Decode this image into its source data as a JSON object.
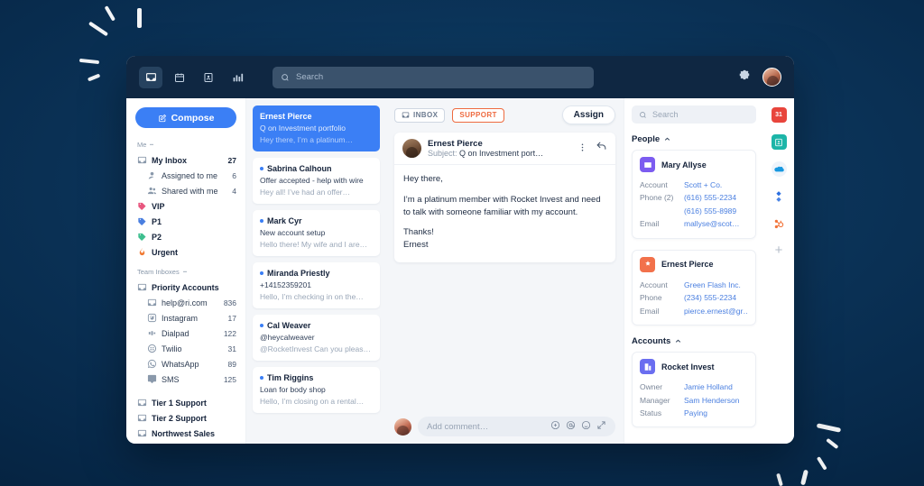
{
  "topbar": {
    "nav": [
      {
        "name": "inbox-icon",
        "label": "Inbox",
        "active": true
      },
      {
        "name": "calendar-icon",
        "label": "Calendar",
        "active": false
      },
      {
        "name": "contacts-icon",
        "label": "Contacts",
        "active": false
      },
      {
        "name": "reports-icon",
        "label": "Reports",
        "active": false
      }
    ],
    "search_placeholder": "Search",
    "settings_label": "Settings",
    "avatar_label": "Account"
  },
  "sidebar": {
    "compose_label": "Compose",
    "group_me": "Me",
    "me_items": [
      {
        "icon": "mail-icon",
        "label": "My Inbox",
        "count": "27",
        "bold": true,
        "sub": false,
        "color": "#8a99ab"
      },
      {
        "icon": "assigned-icon",
        "label": "Assigned to me",
        "count": "6",
        "bold": false,
        "sub": true,
        "color": "#8a99ab"
      },
      {
        "icon": "shared-icon",
        "label": "Shared with me",
        "count": "4",
        "bold": false,
        "sub": true,
        "color": "#8a99ab"
      },
      {
        "icon": "tag-icon",
        "label": "VIP",
        "count": "",
        "bold": true,
        "sub": false,
        "color": "#e8577f"
      },
      {
        "icon": "tag-icon",
        "label": "P1",
        "count": "",
        "bold": true,
        "sub": false,
        "color": "#4a7fe0"
      },
      {
        "icon": "tag-icon",
        "label": "P2",
        "count": "",
        "bold": true,
        "sub": false,
        "color": "#3fbf8f"
      },
      {
        "icon": "flame-icon",
        "label": "Urgent",
        "count": "",
        "bold": true,
        "sub": false,
        "color": "#f07b35"
      }
    ],
    "group_team": "Team Inboxes",
    "team_items": [
      {
        "icon": "mail-icon",
        "label": "Priority Accounts",
        "count": "",
        "bold": true,
        "sub": false,
        "color": "#8a99ab"
      },
      {
        "icon": "mail-icon",
        "label": "help@ri.com",
        "count": "836",
        "bold": false,
        "sub": true,
        "color": "#8a99ab"
      },
      {
        "icon": "instagram-icon",
        "label": "Instagram",
        "count": "17",
        "bold": false,
        "sub": true,
        "color": "#8a99ab"
      },
      {
        "icon": "dialpad-icon",
        "label": "Dialpad",
        "count": "122",
        "bold": false,
        "sub": true,
        "color": "#8a99ab"
      },
      {
        "icon": "twilio-icon",
        "label": "Twilio",
        "count": "31",
        "bold": false,
        "sub": true,
        "color": "#8a99ab"
      },
      {
        "icon": "whatsapp-icon",
        "label": "WhatsApp",
        "count": "89",
        "bold": false,
        "sub": true,
        "color": "#8a99ab"
      },
      {
        "icon": "sms-icon",
        "label": "SMS",
        "count": "125",
        "bold": false,
        "sub": true,
        "color": "#8a99ab"
      }
    ],
    "other_items": [
      {
        "icon": "mail-icon",
        "label": "Tier 1 Support",
        "count": "",
        "bold": true,
        "sub": false,
        "color": "#8a99ab"
      },
      {
        "icon": "mail-icon",
        "label": "Tier 2 Support",
        "count": "",
        "bold": true,
        "sub": false,
        "color": "#8a99ab"
      },
      {
        "icon": "mail-icon",
        "label": "Northwest Sales",
        "count": "",
        "bold": true,
        "sub": false,
        "color": "#8a99ab"
      }
    ]
  },
  "conversations": [
    {
      "name": "Ernest Pierce",
      "subject": "Q on Investment portfolio",
      "preview": "Hey there, I’m a platinum…",
      "selected": true,
      "unread": false
    },
    {
      "name": "Sabrina Calhoun",
      "subject": "Offer accepted - help with wire",
      "preview": "Hey all! I’ve had an offer…",
      "selected": false,
      "unread": true
    },
    {
      "name": "Mark Cyr",
      "subject": "New account setup",
      "preview": "Hello there! My wife and I are…",
      "selected": false,
      "unread": true
    },
    {
      "name": "Miranda Priestly",
      "subject": "+14152359201",
      "preview": "Hello, I’m checking in on the…",
      "selected": false,
      "unread": true
    },
    {
      "name": "Cal Weaver",
      "subject": "@heycalweaver",
      "preview": "@RocketInvest Can you pleas…",
      "selected": false,
      "unread": true
    },
    {
      "name": "Tim Riggins",
      "subject": "Loan for body shop",
      "preview": "Hello, I’m closing on a rental…",
      "selected": false,
      "unread": true
    }
  ],
  "message": {
    "chip_inbox": "INBOX",
    "chip_support": "SUPPORT",
    "assign_label": "Assign",
    "sender": "Ernest Pierce",
    "subject_prefix": "Subject: ",
    "subject": "Q on Investment port…",
    "more_label": "More actions",
    "reply_label": "Reply",
    "paragraphs": [
      "Hey there,",
      "I’m a platinum member with Rocket Invest and need to talk with someone familiar with my account.",
      "Thanks!\nErnest"
    ],
    "comment_placeholder": "Add comment…",
    "comment_icons": [
      "plus-circle-icon",
      "mention-icon",
      "emoji-icon",
      "expand-icon"
    ]
  },
  "details": {
    "search_placeholder": "Search",
    "people_title": "People",
    "accounts_title": "Accounts",
    "people": [
      {
        "name": "Mary Allyse",
        "icon": "contact-card-icon",
        "icon_color": "#7c5cf0",
        "rows": [
          {
            "key": "Account",
            "value": "Scott + Co."
          },
          {
            "key": "Phone (2)",
            "value": "(616) 555-2234"
          },
          {
            "key": "",
            "value": "(616) 555-8989"
          },
          {
            "key": "Email",
            "value": "mallyse@scot…"
          }
        ]
      },
      {
        "name": "Ernest Pierce",
        "icon": "star-contact-icon",
        "icon_color": "#f2714b",
        "rows": [
          {
            "key": "Account",
            "value": "Green Flash Inc."
          },
          {
            "key": "Phone",
            "value": "(234) 555-2234"
          },
          {
            "key": "Email",
            "value": "pierce.ernest@gr…"
          }
        ]
      }
    ],
    "accounts": [
      {
        "name": "Rocket Invest",
        "icon": "building-icon",
        "icon_color": "#6a6ef0",
        "rows": [
          {
            "key": "Owner",
            "value": "Jamie Holland"
          },
          {
            "key": "Manager",
            "value": "Sam Henderson"
          },
          {
            "key": "Status",
            "value": "Paying"
          }
        ]
      }
    ]
  },
  "rail": {
    "items": [
      {
        "name": "google-calendar-icon",
        "label": "31",
        "color": "#e8453c"
      },
      {
        "name": "contacts-app-icon",
        "label": "",
        "color": "#1cb5a8"
      },
      {
        "name": "salesforce-icon",
        "label": "",
        "color": "#1798e0"
      },
      {
        "name": "jira-icon",
        "label": "",
        "color": "#2c6fe0"
      },
      {
        "name": "hubspot-icon",
        "label": "",
        "color": "#f2743a"
      },
      {
        "name": "add-integration-icon",
        "label": "+",
        "color": "#b3bcc8"
      }
    ]
  },
  "colors": {
    "accent_blue": "#3b7ff5",
    "support_orange": "#ee6a3f",
    "topbar_dark": "#0f2742",
    "page_bg": "#0b3358"
  }
}
